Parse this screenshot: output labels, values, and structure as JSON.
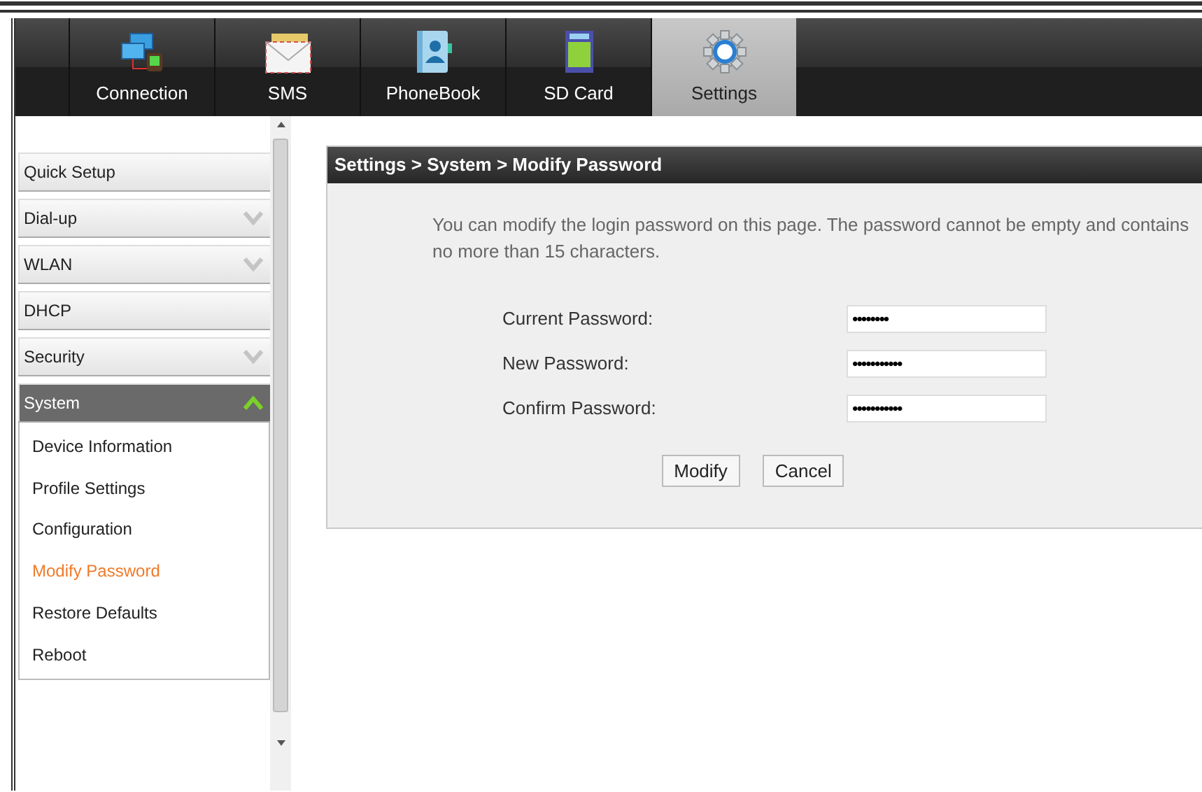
{
  "nav_tabs": [
    {
      "label": "Connection",
      "kind": "connection",
      "selected": false
    },
    {
      "label": "SMS",
      "kind": "sms",
      "selected": false
    },
    {
      "label": "PhoneBook",
      "kind": "phonebook",
      "selected": false
    },
    {
      "label": "SD Card",
      "kind": "sdcard",
      "selected": false
    },
    {
      "label": "Settings",
      "kind": "settings",
      "selected": true
    }
  ],
  "sidebar": {
    "items": [
      {
        "label": "Quick Setup",
        "kind": "plain"
      },
      {
        "label": "Dial-up",
        "kind": "collapsible",
        "expanded": false
      },
      {
        "label": "WLAN",
        "kind": "collapsible",
        "expanded": false
      },
      {
        "label": "DHCP",
        "kind": "plain"
      },
      {
        "label": "Security",
        "kind": "collapsible",
        "expanded": false
      },
      {
        "label": "System",
        "kind": "collapsible",
        "expanded": true,
        "children": [
          {
            "label": "Device Information",
            "selected": false
          },
          {
            "label": "Profile Settings",
            "selected": false
          },
          {
            "label": "Configuration",
            "selected": false
          },
          {
            "label": "Modify Password",
            "selected": true
          },
          {
            "label": "Restore Defaults",
            "selected": false
          },
          {
            "label": "Reboot",
            "selected": false
          }
        ]
      }
    ]
  },
  "panel": {
    "title": "Settings > System > Modify Password",
    "description": "You can modify the login password on this page. The password cannot be empty and contains no more than 15 characters.",
    "fields": [
      {
        "label": "Current Password:",
        "value": "••••••••"
      },
      {
        "label": "New Password:",
        "value": "•••••••••••"
      },
      {
        "label": "Confirm Password:",
        "value": "•••••••••••"
      }
    ],
    "buttons": [
      "Modify",
      "Cancel"
    ]
  }
}
